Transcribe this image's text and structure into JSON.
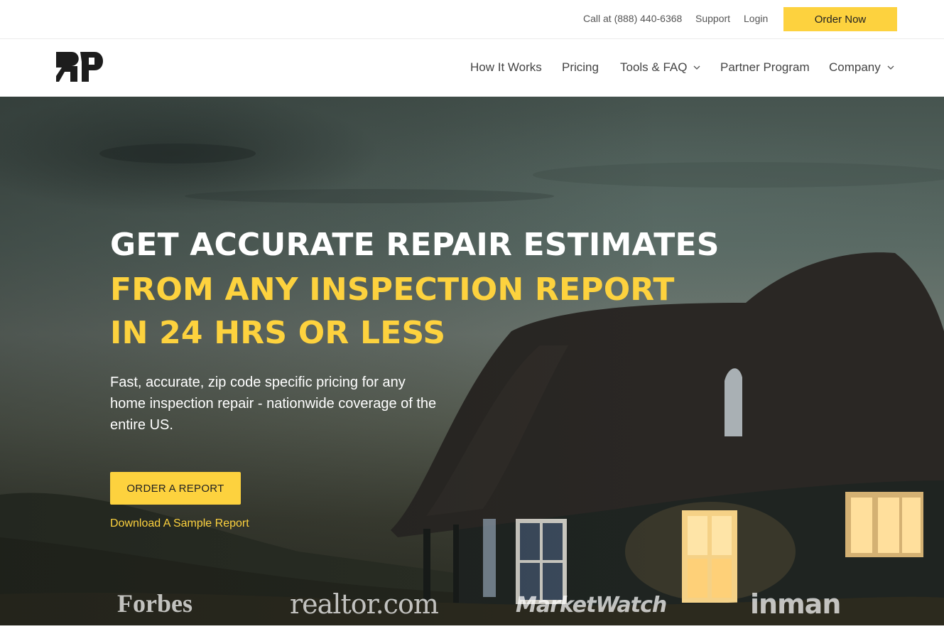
{
  "topbar": {
    "phone": "Call at (888) 440-6368",
    "support": "Support",
    "login": "Login",
    "order_now": "Order Now"
  },
  "nav": {
    "logo_icon": "rp-logo-icon",
    "items": [
      {
        "label": "How It Works",
        "dropdown": false
      },
      {
        "label": "Pricing",
        "dropdown": false
      },
      {
        "label": "Tools & FAQ",
        "dropdown": true
      },
      {
        "label": "Partner Program",
        "dropdown": false
      },
      {
        "label": "Company",
        "dropdown": true
      }
    ]
  },
  "hero": {
    "headline_line1": "GET ACCURATE REPAIR ESTIMATES",
    "headline_line2": "FROM ANY INSPECTION REPORT",
    "headline_line3": "IN 24 HRS OR LESS",
    "subtext": "Fast, accurate, zip code specific pricing for any home inspection repair - nationwide coverage of the entire US.",
    "cta_label": "ORDER A REPORT",
    "sample_link": "Download A Sample Report"
  },
  "press": [
    "Forbes",
    "realtor.com",
    "MarketWatch",
    "inman"
  ],
  "colors": {
    "accent": "#fdd23e",
    "nav_text": "#444444",
    "headline_white": "#ffffff"
  }
}
